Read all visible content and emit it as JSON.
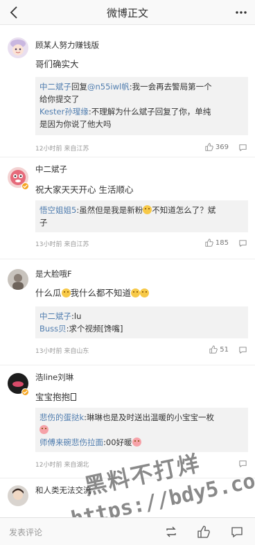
{
  "header": {
    "title": "微博正文"
  },
  "comments": [
    {
      "user": "顾某人努力赚钱版",
      "text": "哥们确实大",
      "replies": [
        {
          "name": "中二斌子",
          "mid": "回复",
          "mention": "@n55iwl帆",
          "text": ":我一会再去警局第一个"
        },
        {
          "cont": "给你提交了"
        },
        {
          "name": "Kester孙瑆缘",
          "text": ":不理解为什么斌子回复了你，单纯"
        },
        {
          "cont": "是因为你说了他大吗"
        }
      ],
      "time": "12小时前 来自江苏",
      "likes": "369"
    },
    {
      "user": "中二斌子",
      "text": "祝大家天天开心 生活顺心",
      "replies": [
        {
          "name": "悟空姐姐5",
          "text": ":虽然但是我是新粉",
          "text2": "不知道怎么了？斌"
        },
        {
          "cont": "子"
        }
      ],
      "time": "13小时前 来自江苏",
      "likes": "185"
    },
    {
      "user": "是大脸哦F",
      "text": "什么瓜",
      "text2": "我什么都不知道",
      "replies": [
        {
          "name": "中二斌子",
          "text": ":lu"
        },
        {
          "name": "Buss贝",
          "text": ":求个视频[馋嘴]"
        }
      ],
      "time": "13小时前 来自山东",
      "likes": "51"
    },
    {
      "user": "浩line刘琳",
      "text": "宝宝抱抱",
      "replies": [
        {
          "name": "悲伤的蛋挞k",
          "text": ":琳琳也是及时送出温暖的小宝宝一枚"
        },
        {
          "cont": ""
        },
        {
          "name": "师傅来碗悲伤拉面",
          "text": ":00好暖"
        }
      ],
      "time": "12小时前 来自湖北",
      "likes": ""
    },
    {
      "user": "和人类无法交流",
      "text": ""
    }
  ],
  "bottom": {
    "placeholder": "发表评论"
  },
  "watermark": {
    "line1": "黑料不打烊",
    "line2": "https://bdy5.co"
  },
  "colors": {
    "link": "#507daf",
    "badge": "#f5a623"
  }
}
